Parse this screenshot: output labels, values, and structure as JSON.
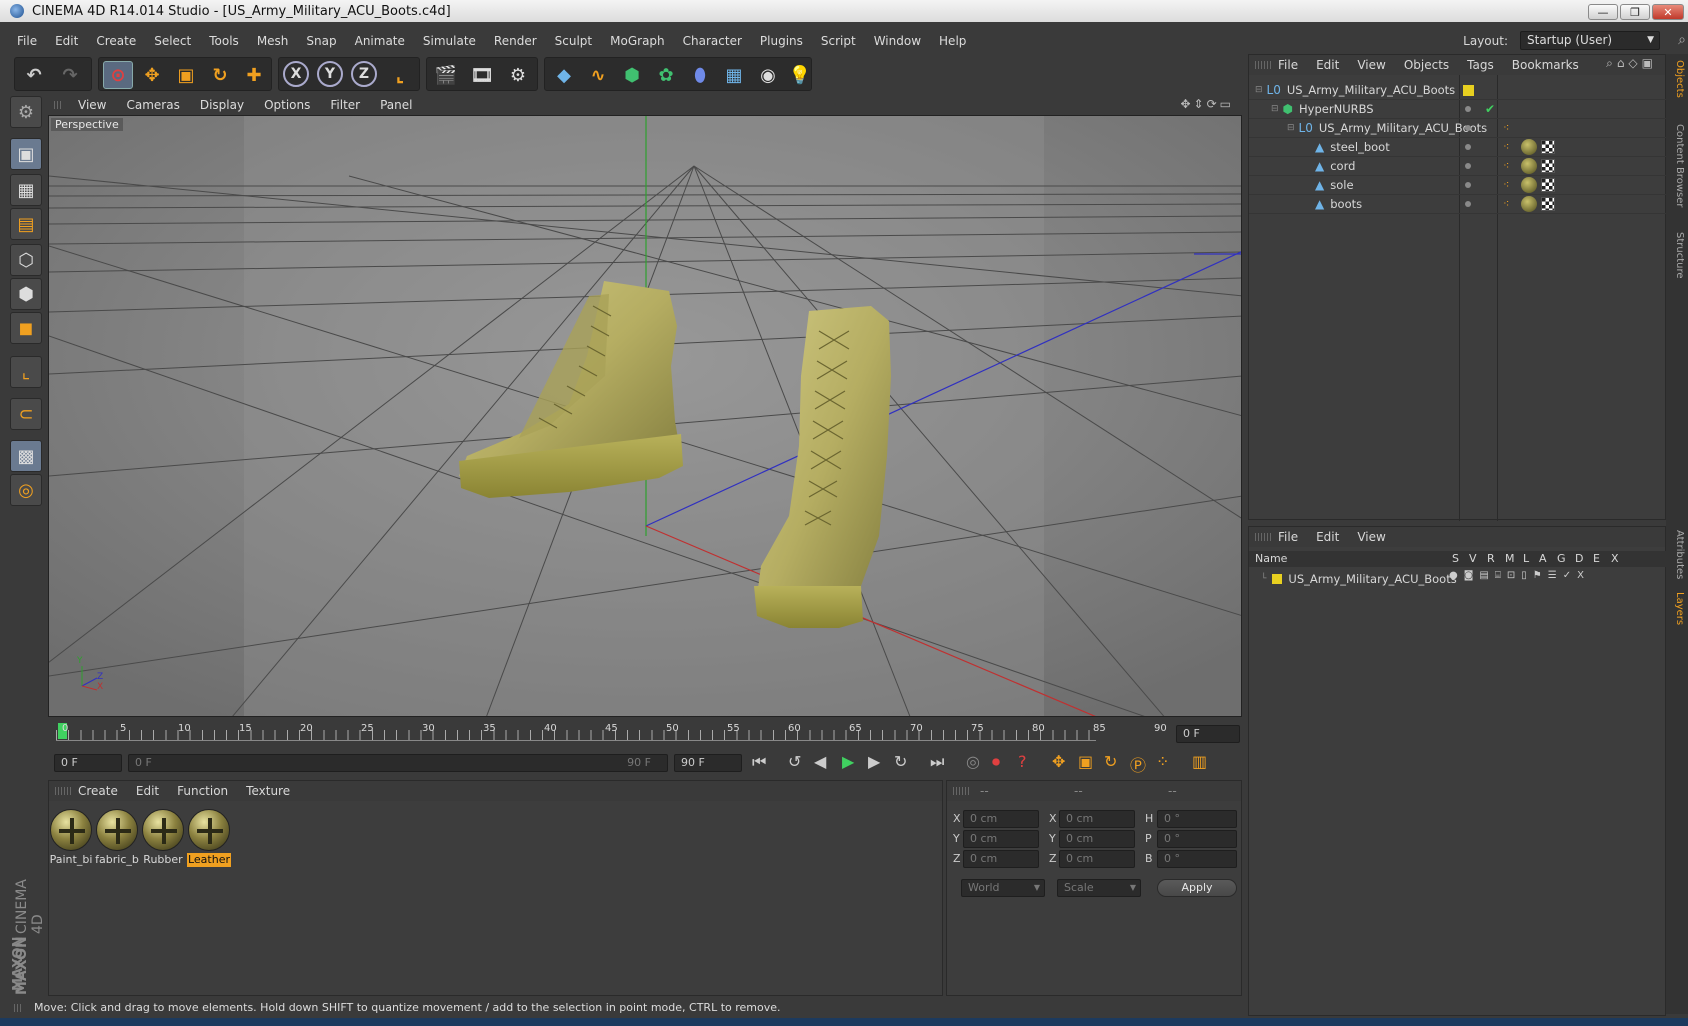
{
  "window": {
    "title": "CINEMA 4D R14.014 Studio - [US_Army_Military_ACU_Boots.c4d]",
    "minimize": "—",
    "restore": "❐",
    "close": "✕"
  },
  "menubar": {
    "items": [
      "File",
      "Edit",
      "Create",
      "Select",
      "Tools",
      "Mesh",
      "Snap",
      "Animate",
      "Simulate",
      "Render",
      "Sculpt",
      "MoGraph",
      "Character",
      "Plugins",
      "Script",
      "Window",
      "Help"
    ],
    "layout_label": "Layout:",
    "layout_value": "Startup (User)"
  },
  "toolbar": {
    "undo_icon": "undo-icon",
    "redo_icon": "redo-icon",
    "axis_x": "X",
    "axis_y": "Y",
    "axis_z": "Z"
  },
  "viewport": {
    "menu": [
      "View",
      "Cameras",
      "Display",
      "Options",
      "Filter",
      "Panel"
    ],
    "label": "Perspective",
    "axis_y": "Y",
    "axis_z": "Z",
    "axis_x": "X"
  },
  "timeline": {
    "ticks": [
      "0",
      "5",
      "10",
      "15",
      "20",
      "25",
      "30",
      "35",
      "40",
      "45",
      "50",
      "55",
      "60",
      "65",
      "70",
      "75",
      "80",
      "85",
      "90"
    ],
    "current_frame": "0 F"
  },
  "transport": {
    "start_field": "0 F",
    "range_start": "0 F",
    "range_end": "90 F",
    "end_field": "90 F"
  },
  "objects_panel": {
    "menu": [
      "File",
      "Edit",
      "View",
      "Objects",
      "Tags",
      "Bookmarks"
    ],
    "rows": [
      {
        "name": "US_Army_Military_ACU_Boots",
        "indent": 0,
        "icon": "null-icon"
      },
      {
        "name": "HyperNURBS",
        "indent": 1,
        "icon": "hypernurbs-icon"
      },
      {
        "name": "US_Army_Military_ACU_Boots",
        "indent": 2,
        "icon": "null-icon"
      },
      {
        "name": "steel_boot",
        "indent": 3,
        "icon": "polygon-icon"
      },
      {
        "name": "cord",
        "indent": 3,
        "icon": "polygon-icon"
      },
      {
        "name": "sole",
        "indent": 3,
        "icon": "polygon-icon"
      },
      {
        "name": "boots",
        "indent": 3,
        "icon": "polygon-icon"
      }
    ]
  },
  "layers_panel": {
    "menu": [
      "File",
      "Edit",
      "View"
    ],
    "columns": [
      "Name",
      "S",
      "V",
      "R",
      "M",
      "L",
      "A",
      "G",
      "D",
      "E",
      "X"
    ],
    "row_name": "US_Army_Military_ACU_Boots",
    "layer_color": "#e8d020"
  },
  "right_tabs": [
    "Objects",
    "Content Browser",
    "Structure",
    "Attributes",
    "Layers"
  ],
  "materials": {
    "menu": [
      "Create",
      "Edit",
      "Function",
      "Texture"
    ],
    "items": [
      {
        "label": "Paint_bi",
        "selected": false
      },
      {
        "label": "fabric_b",
        "selected": false
      },
      {
        "label": "Rubber",
        "selected": false
      },
      {
        "label": "Leather",
        "selected": true
      }
    ]
  },
  "coordinates": {
    "header": [
      "--",
      "--",
      "--"
    ],
    "rows": [
      {
        "a": "X",
        "av": "0 cm",
        "b": "X",
        "bv": "0 cm",
        "c": "H",
        "cv": "0 °"
      },
      {
        "a": "Y",
        "av": "0 cm",
        "b": "Y",
        "bv": "0 cm",
        "c": "P",
        "cv": "0 °"
      },
      {
        "a": "Z",
        "av": "0 cm",
        "b": "Z",
        "bv": "0 cm",
        "c": "B",
        "cv": "0 °"
      }
    ],
    "space": "World",
    "mode": "Scale",
    "apply": "Apply"
  },
  "statusbar": {
    "text": "Move: Click and drag to move elements. Hold down SHIFT to quantize movement / add to the selection in point mode, CTRL to remove."
  },
  "branding": {
    "maxon": "MAXON",
    "product": "CINEMA 4D"
  },
  "colors": {
    "accent_orange": "#f0a020",
    "boot_khaki": "#b8b064",
    "grid_green": "#2fa02f",
    "axis_red": "#c03030",
    "axis_blue": "#3030c0"
  }
}
